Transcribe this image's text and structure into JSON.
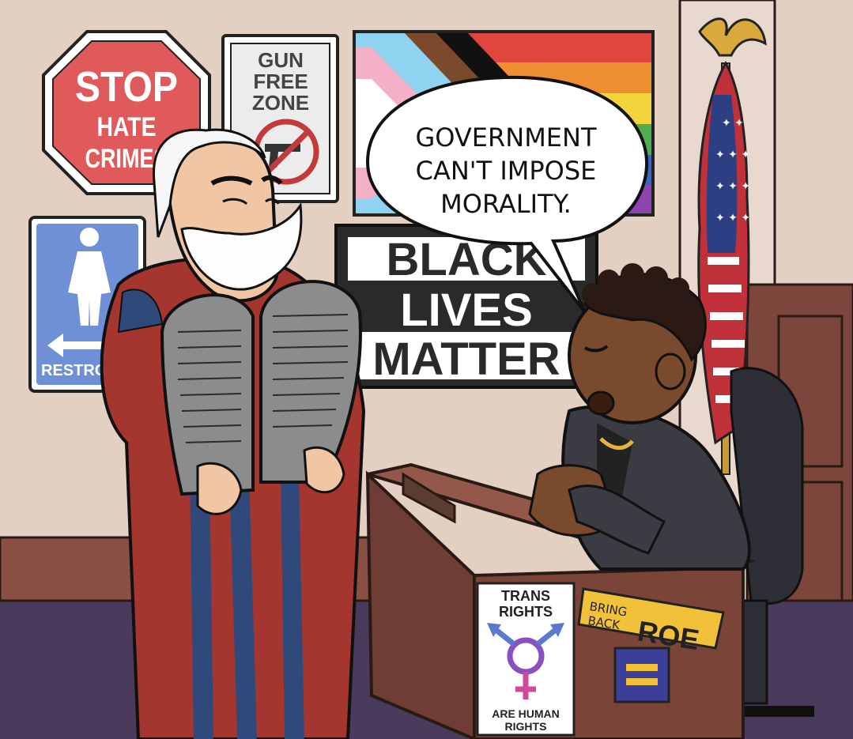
{
  "comic": {
    "speech_bubble": {
      "line1": "GOVERNMENT",
      "line2": "CAN'T IMPOSE",
      "line3": "MORALITY."
    },
    "stop_sign": {
      "line1": "STOP",
      "line2": "HATE",
      "line3": "CRIMES"
    },
    "gun_sign": {
      "line1": "GUN",
      "line2": "FREE",
      "line3": "ZONE"
    },
    "restroom_sign": {
      "label": "RESTRO"
    },
    "blm_sign": {
      "line1": "BLACK",
      "line2": "LIVES",
      "line3": "MATTER"
    },
    "trans_sticker": {
      "line1": "TRANS",
      "line2": "RIGHTS",
      "line3": "ARE HUMAN",
      "line4": "RIGHTS"
    },
    "roe_sticker": {
      "small1": "BRING",
      "small2": "BACK",
      "big": "ROE"
    }
  },
  "colors": {
    "wall": "#e4cfc3",
    "wainscot": "#8a4f45",
    "floor": "#4a3a5c",
    "stop_red": "#e05a5c",
    "restroom_blue": "#6f8fd6",
    "robe_red": "#a5362f",
    "robe_blue": "#2f4a7a",
    "tablet_gray": "#8c8c8c",
    "desk_brown": "#7a4538",
    "skin_dark": "#7a4a2e",
    "skin_light": "#f1c6a4",
    "suit": "#3b3c43"
  }
}
